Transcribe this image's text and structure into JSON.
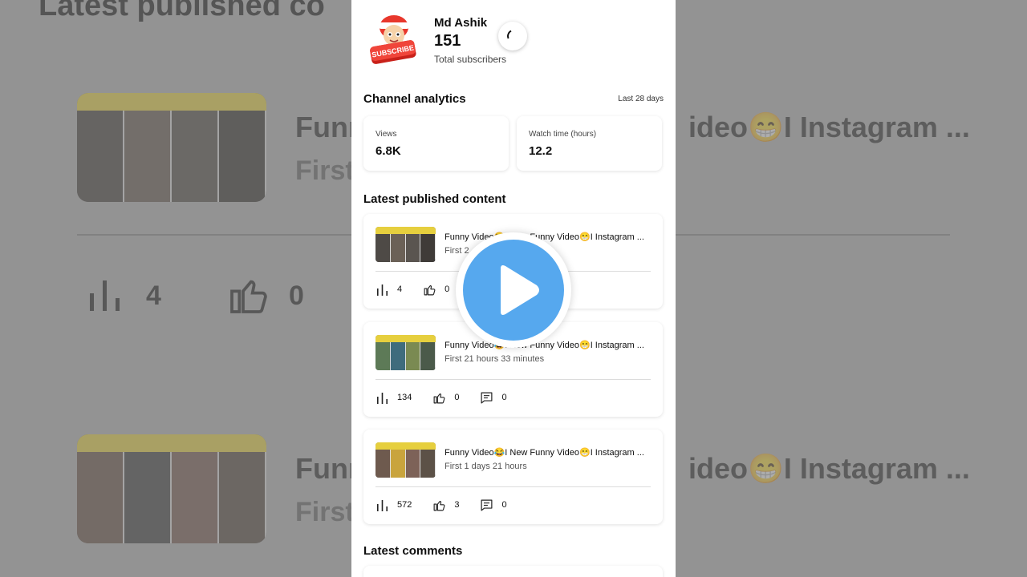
{
  "channel": {
    "name": "Md Ashik",
    "subscribers": "151",
    "subscribers_label": "Total subscribers",
    "avatar_text": "SUBSCRIBE"
  },
  "analytics": {
    "title": "Channel analytics",
    "period": "Last 28 days",
    "metrics": [
      {
        "label": "Views",
        "value": "6.8K"
      },
      {
        "label": "Watch time (hours)",
        "value": "12.2"
      }
    ]
  },
  "latest_content": {
    "title": "Latest published content",
    "videos": [
      {
        "title": "Funny Video😂I New Funny Video😁I Instagram ...",
        "published": "First 2",
        "views": "4",
        "likes": "0",
        "comments": ""
      },
      {
        "title": "Funny Video😂I New Funny Video😁I Instagram ...",
        "published": "First 21 hours 33 minutes",
        "views": "134",
        "likes": "0",
        "comments": "0"
      },
      {
        "title": "Funny Video😂I New Funny Video😁I Instagram ...",
        "published": "First 1 days 21 hours",
        "views": "572",
        "likes": "3",
        "comments": "0"
      }
    ]
  },
  "latest_comments": {
    "title": "Latest comments"
  },
  "background": {
    "heading": "Latest published co",
    "row1_title": "Funny",
    "row1_title_right": "ideo😁I Instagram ...",
    "row1_sub": "First",
    "row2_title": "Funn",
    "row2_title_right": "ideo😁I Instagram ...",
    "row2_sub": "First",
    "views": "4",
    "likes": "0"
  },
  "overlay": {
    "icon": "play-icon",
    "color": "#56a8ee"
  },
  "icons": {
    "views": "bar-chart-icon",
    "likes": "thumb-up-icon",
    "comments": "comment-icon",
    "loading": "spinner-icon"
  }
}
